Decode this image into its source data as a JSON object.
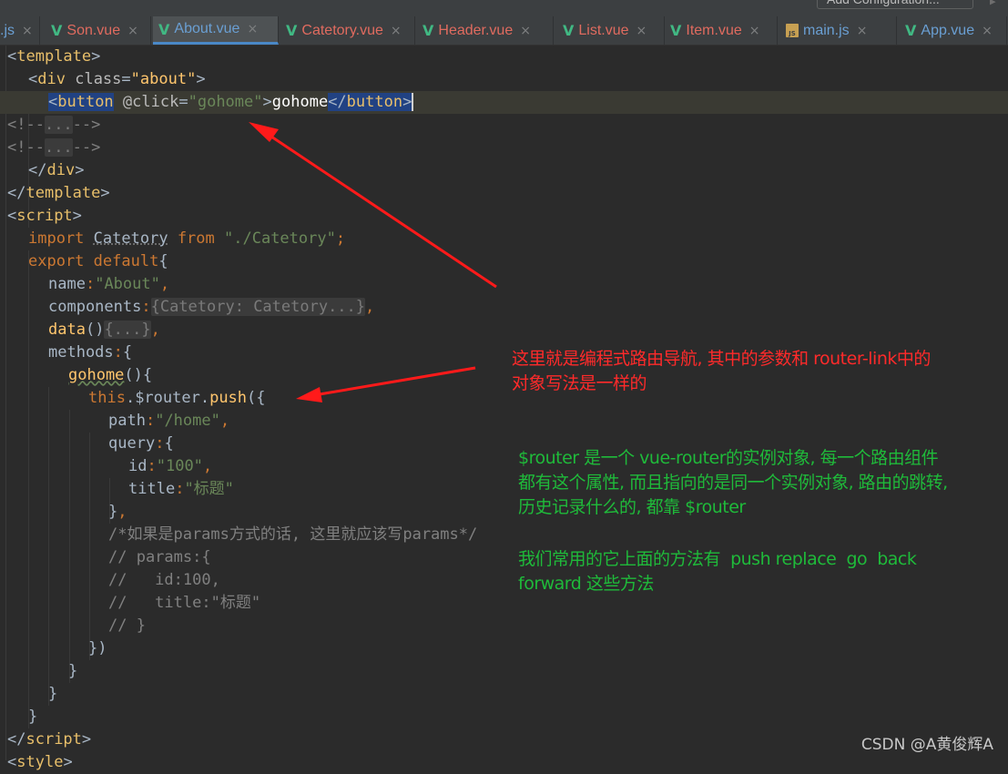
{
  "toolbar": {
    "run_config_label": "Add Configuration...",
    "play_glyph": "▶"
  },
  "tabs": [
    {
      "label": ".js",
      "icon": "js-file-icon",
      "active": false
    },
    {
      "label": "Son.vue",
      "icon": "vue-file-icon",
      "active": false
    },
    {
      "label": "About.vue",
      "icon": "vue-file-icon",
      "active": true
    },
    {
      "label": "Catetory.vue",
      "icon": "vue-file-icon",
      "active": false
    },
    {
      "label": "Header.vue",
      "icon": "vue-file-icon",
      "active": false
    },
    {
      "label": "List.vue",
      "icon": "vue-file-icon",
      "active": false
    },
    {
      "label": "Item.vue",
      "icon": "vue-file-icon",
      "active": false
    },
    {
      "label": "main.js",
      "icon": "js-file-icon",
      "active": false
    },
    {
      "label": "App.vue",
      "icon": "vue-file-icon",
      "active": false
    }
  ],
  "tab_close_glyph": "×",
  "code": {
    "l1_tag": "template",
    "l2_tag": "div",
    "l2_attr": "class",
    "l2_val": "about",
    "l3_tag": "button",
    "l3_attr": "@click",
    "l3_val": "gohome",
    "l3_text": "gohome",
    "l4_fold": "...",
    "l5_fold": "...",
    "l6_tag": "div",
    "l7_tag": "template",
    "l8_tag": "script",
    "l9_import": "import",
    "l9_name": "Catetory",
    "l9_from": "from",
    "l9_path": "\"./Catetory\"",
    "l10_export": "export",
    "l10_default": "default",
    "l11_key": "name",
    "l11_val": "\"About\"",
    "l12_key": "components",
    "l12_fold": "{Catetory: Catetory...}",
    "l13_key": "data",
    "l13_fold": "{...}",
    "l14_key": "methods",
    "l15_fn": "gohome",
    "l16_this": "this",
    "l16_router": ".$router.",
    "l16_push": "push",
    "l17_key": "path",
    "l17_val": "\"/home\"",
    "l18_key": "query",
    "l19_key": "id",
    "l19_val": "\"100\"",
    "l20_key": "title",
    "l20_val": "\"标题\"",
    "l22_comment": "/*如果是params方式的话, 这里就应该写params*/",
    "l23_comment": "// params:{",
    "l24_comment": "//   id:100,",
    "l25_comment": "//   title:\"标题\"",
    "l26_comment": "// }",
    "l31_tag": "script",
    "l32_tag": "style"
  },
  "annotations": {
    "red_note": "这里就是编程式路由导航, 其中的参数和 router-link中的\n对象写法是一样的",
    "green_note_1": "$router 是一个 vue-router的实例对象, 每一个路由组件\n都有这个属性, 而且指向的是同一个实例对象, 路由的跳转,\n历史记录什么的, 都靠 $router",
    "green_note_2": "我们常用的它上面的方法有  push replace  go  back\nforward 这些方法",
    "red_color": "#ff2a2a",
    "green_color": "#1fba3a"
  },
  "watermark": "CSDN @A黄俊辉A"
}
